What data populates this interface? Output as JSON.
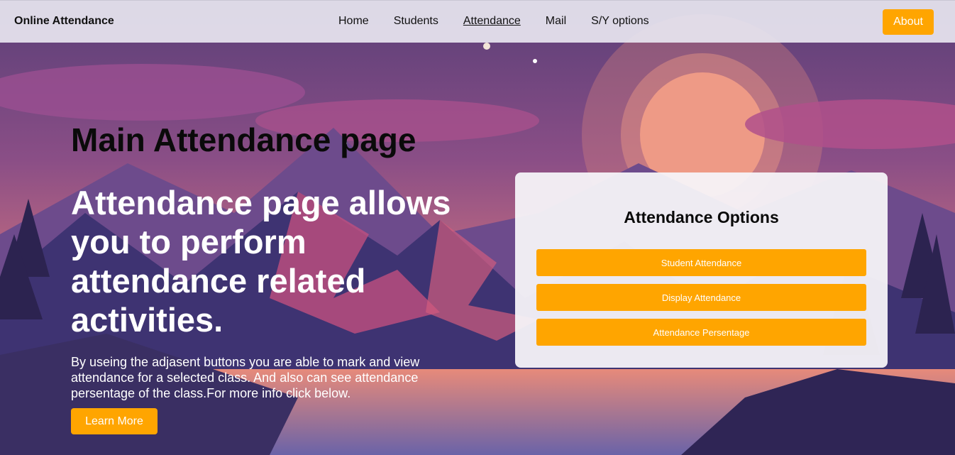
{
  "navbar": {
    "brand": "Online Attendance",
    "links": [
      {
        "label": "Home"
      },
      {
        "label": "Students"
      },
      {
        "label": "Attendance"
      },
      {
        "label": "Mail"
      },
      {
        "label": "S/Y options"
      }
    ],
    "about_label": "About"
  },
  "hero": {
    "page_title": "Main Attendance page",
    "headline": "Attendance page allows you to perform attendance related activities.",
    "description": "By useing the adjasent buttons you are able to mark and view attendance for a selected class. And also can see attendance persentage of the class.For more info click below.",
    "learn_more_label": "Learn More"
  },
  "options_card": {
    "title": "Attendance Options",
    "buttons": [
      {
        "label": "Student Attendance"
      },
      {
        "label": "Display Attendance"
      },
      {
        "label": "Attendance Persentage"
      }
    ]
  },
  "colors": {
    "accent": "#ffa500",
    "navbar_bg": "#e8e6f0",
    "card_bg": "#f5f3f8"
  }
}
